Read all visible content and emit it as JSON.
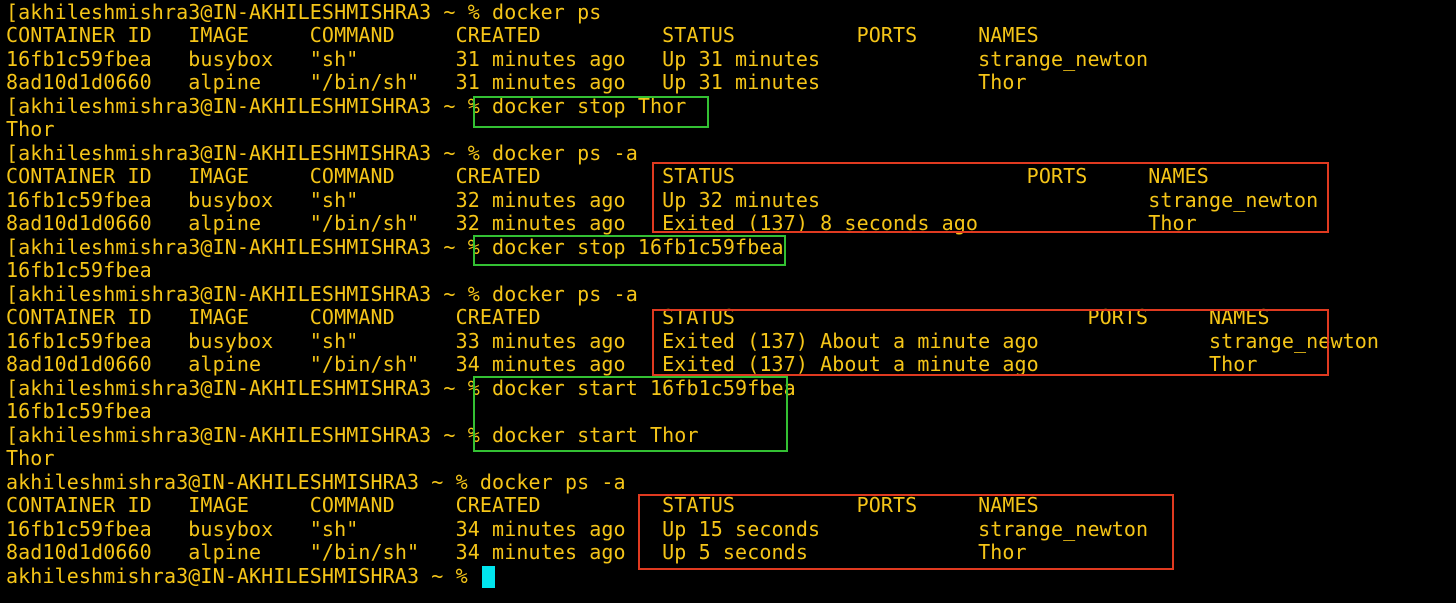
{
  "terminal": {
    "colors": {
      "background": "#000000",
      "text": "#f5c518",
      "cursor": "#00e5ee",
      "command_highlight": "#33c033",
      "output_highlight": "#e03a20"
    },
    "lines": [
      "[akhileshmishra3@IN-AKHILESHMISHRA3 ~ % docker ps",
      "CONTAINER ID   IMAGE     COMMAND     CREATED          STATUS          PORTS     NAMES",
      "16fb1c59fbea   busybox   \"sh\"        31 minutes ago   Up 31 minutes             strange_newton",
      "8ad10d1d0660   alpine    \"/bin/sh\"   31 minutes ago   Up 31 minutes             Thor",
      "[akhileshmishra3@IN-AKHILESHMISHRA3 ~ % docker stop Thor",
      "Thor",
      "[akhileshmishra3@IN-AKHILESHMISHRA3 ~ % docker ps -a",
      "CONTAINER ID   IMAGE     COMMAND     CREATED          STATUS                        PORTS     NAMES",
      "16fb1c59fbea   busybox   \"sh\"        32 minutes ago   Up 32 minutes                           strange_newton",
      "8ad10d1d0660   alpine    \"/bin/sh\"   32 minutes ago   Exited (137) 8 seconds ago              Thor",
      "[akhileshmishra3@IN-AKHILESHMISHRA3 ~ % docker stop 16fb1c59fbea",
      "16fb1c59fbea",
      "[akhileshmishra3@IN-AKHILESHMISHRA3 ~ % docker ps -a",
      "CONTAINER ID   IMAGE     COMMAND     CREATED          STATUS                             PORTS     NAMES",
      "16fb1c59fbea   busybox   \"sh\"        33 minutes ago   Exited (137) About a minute ago              strange_newton",
      "8ad10d1d0660   alpine    \"/bin/sh\"   34 minutes ago   Exited (137) About a minute ago              Thor",
      "[akhileshmishra3@IN-AKHILESHMISHRA3 ~ % docker start 16fb1c59fbea",
      "16fb1c59fbea",
      "[akhileshmishra3@IN-AKHILESHMISHRA3 ~ % docker start Thor",
      "Thor",
      "akhileshmishra3@IN-AKHILESHMISHRA3 ~ % docker ps -a",
      "CONTAINER ID   IMAGE     COMMAND     CREATED          STATUS          PORTS     NAMES",
      "16fb1c59fbea   busybox   \"sh\"        34 minutes ago   Up 15 seconds             strange_newton",
      "8ad10d1d0660   alpine    \"/bin/sh\"   34 minutes ago   Up 5 seconds              Thor",
      "akhileshmishra3@IN-AKHILESHMISHRA3 ~ % "
    ]
  }
}
